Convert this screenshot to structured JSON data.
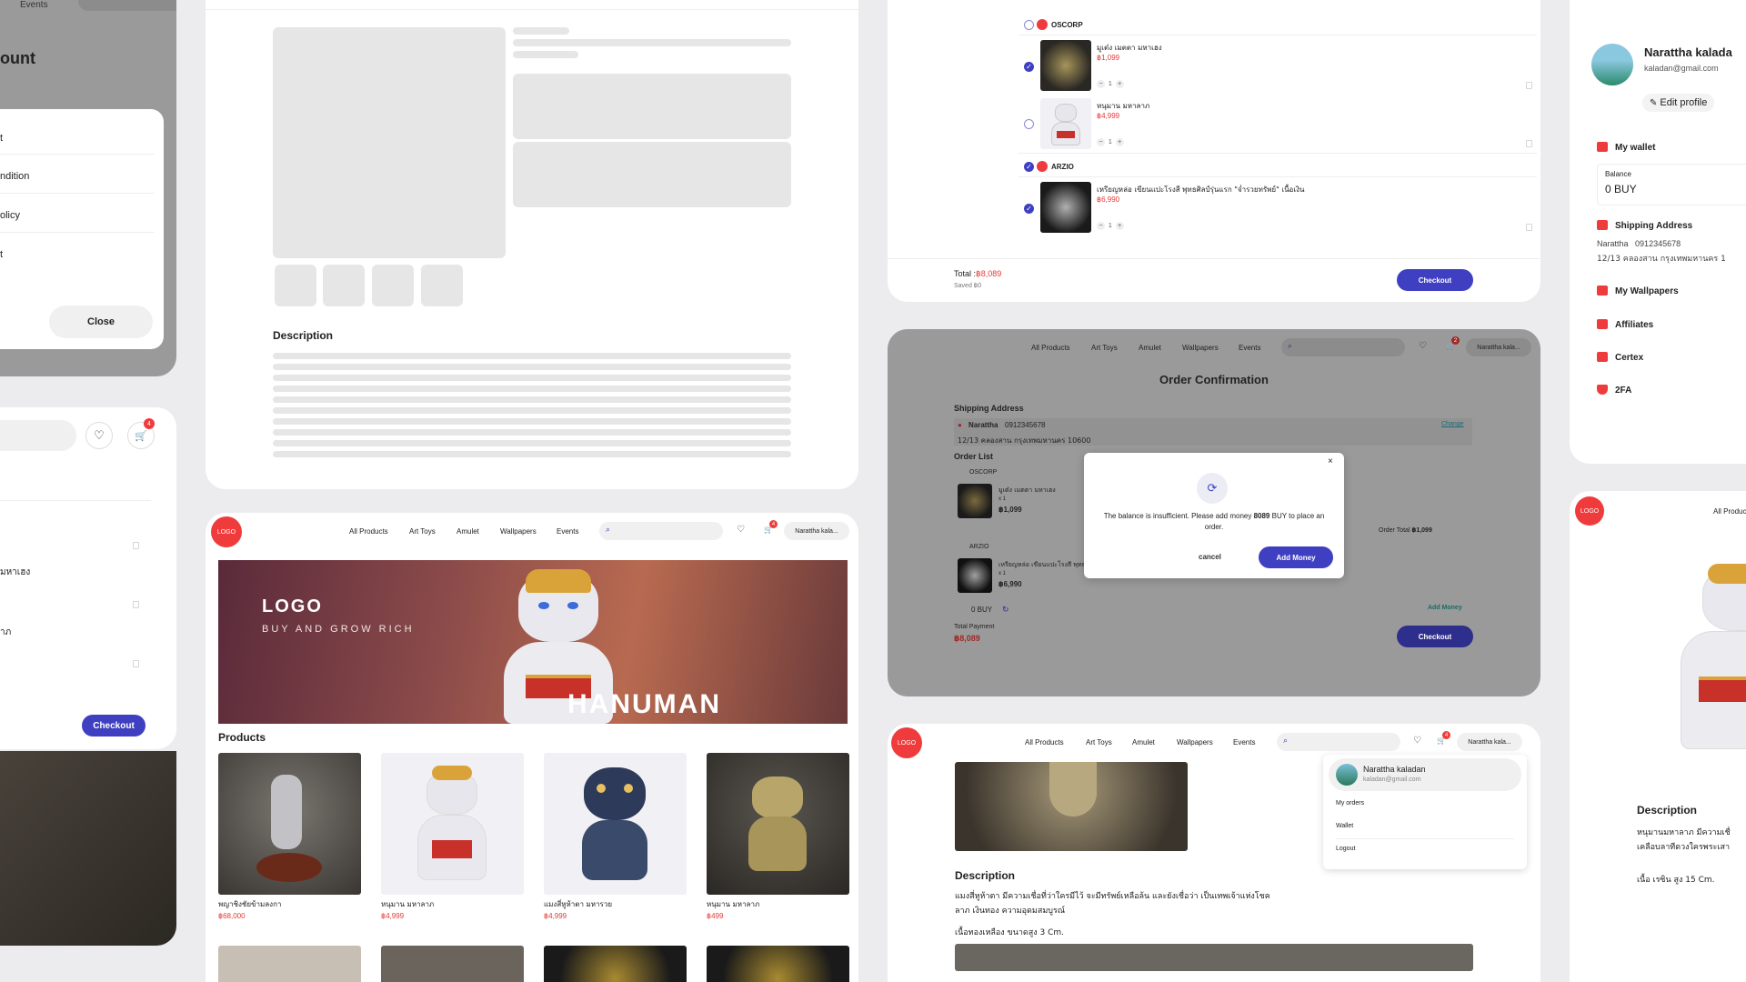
{
  "colors": {
    "accent": "#3f3fc2",
    "price": "#e53935",
    "logo": "#ef3b3b"
  },
  "a": {
    "nav_events": "Events",
    "title_frag": "ount",
    "items": [
      "t",
      "ndition",
      "olicy",
      "t"
    ],
    "close": "Close"
  },
  "b": {
    "cart_count": "4",
    "items": [
      "มหาเฮง",
      "าภ"
    ],
    "checkout": "Checkout"
  },
  "c": {
    "description": "Description"
  },
  "d": {
    "logo": "LOGO",
    "nav": [
      "All Products",
      "Art Toys",
      "Amulet",
      "Wallpapers",
      "Events"
    ],
    "user": "Narattha kala...",
    "cart_count": "4",
    "banner_logo": "LOGO",
    "banner_tag": "BUY AND GROW RICH",
    "banner_title": "HANUMAN",
    "section": "Products",
    "products": [
      {
        "name": "พญาชิงชัยข้ามลงกา",
        "price": "฿68,000"
      },
      {
        "name": "หนุมาน มหาลาภ",
        "price": "฿4,999"
      },
      {
        "name": "แมงสี่หูห้าตา มหารวย",
        "price": "฿4,999"
      },
      {
        "name": "หนุมาน มหาลาภ",
        "price": "฿499"
      }
    ]
  },
  "e": {
    "shops": [
      {
        "name": "OSCORP",
        "items": [
          {
            "name": "มูเต๋ง เมตตา มหาเฮง",
            "price": "฿1,099",
            "qty": "1"
          },
          {
            "name": "หนุมาน มหาลาภ",
            "price": "฿4,999",
            "qty": "1"
          }
        ]
      },
      {
        "name": "ARZIO",
        "items": [
          {
            "name": "เหรียญหล่อ เขียนแปะโรงสี พุทธศิลป์รุ่นแรก \"จ่ำรวยทรัพย์\" เนื้อเงิน",
            "price": "฿6,990",
            "qty": "1"
          }
        ]
      }
    ],
    "total_label": "Total :",
    "total": "฿8,089",
    "saved": "Saved ฿0",
    "checkout": "Checkout"
  },
  "f": {
    "nav": [
      "All Products",
      "Art Toys",
      "Amulet",
      "Wallpapers",
      "Events"
    ],
    "user": "Narattha kala...",
    "cart_count": "2",
    "title": "Order Confirmation",
    "shipping_label": "Shipping Address",
    "name": "Narattha",
    "phone": "0912345678",
    "address": "12/13 คลองสาน กรุงเทพมหานคร 10600",
    "change": "Change",
    "order_list": "Order List",
    "shop1": "OSCORP",
    "item1_name": "มูเต๋ง เมตตา มหาเฮง",
    "item1_qty": "x 1",
    "item1_price": "฿1,099",
    "order_total_label": "Order Total",
    "order_total": "฿1,099",
    "shop2": "ARZIO",
    "item2_name": "เหรียญหล่อ เขียนแปะโรงสี พุทธศิลป์รุ่นแรก \"จ่ำรวยทรัพย์\" เนื้อเงิน",
    "item2_qty": "x 1",
    "item2_price": "฿6,990",
    "balance": "0 BUY",
    "add_money_link": "Add Money",
    "total_payment_label": "Total Payment",
    "total_payment": "฿8,089",
    "checkout": "Checkout",
    "modal": {
      "msg_a": "The balance is insufficient. Please add money",
      "msg_amount": "8089",
      "msg_b": "BUY to place an order.",
      "cancel": "cancel",
      "add": "Add Money"
    }
  },
  "g": {
    "logo": "LOGO",
    "nav": [
      "All Products",
      "Art Toys",
      "Amulet",
      "Wallpapers",
      "Events"
    ],
    "user": "Narattha kala...",
    "cart_count": "4",
    "dropdown": {
      "name": "Narattha kaladan",
      "email": "kaladan@gmail.com",
      "items": [
        "My orders",
        "Wallet",
        "Logout"
      ]
    },
    "description": "Description",
    "desc_line1": "แมงสี่หูห้าตา มีความเชื่อที่ว่าใครมีไว้ จะมีทรัพย์เหลือล้น และยังเชื่อว่า เป็นเทพเจ้าแห่งโชค",
    "desc_line2": "ลาภ เงินทอง ความอุดมสมบูรณ์",
    "desc_line3": "เนื้อทองเหลือง ขนาดสูง 3 Cm."
  },
  "h": {
    "name": "Narattha kalada",
    "email": "kaladan@gmail.com",
    "edit": "Edit profile",
    "wallet": "My wallet",
    "balance_label": "Balance",
    "balance": "0 BUY",
    "shipping": "Shipping Address",
    "ship_name": "Narattha",
    "ship_phone": "0912345678",
    "ship_addr": "12/13 คลองสาน กรุงเทพมหานคร 1",
    "menu": [
      "My Wallpapers",
      "Affiliates",
      "Certex",
      "2FA"
    ]
  },
  "i": {
    "logo": "LOGO",
    "nav": "All Produc",
    "description": "Description",
    "desc1": "หนุมานมหาลาภ มีความเชื่",
    "desc2": "เคลือบลาทีดวงใครพระเสา",
    "desc3": "เนื้อ เรซิน สูง 15 Cm."
  }
}
